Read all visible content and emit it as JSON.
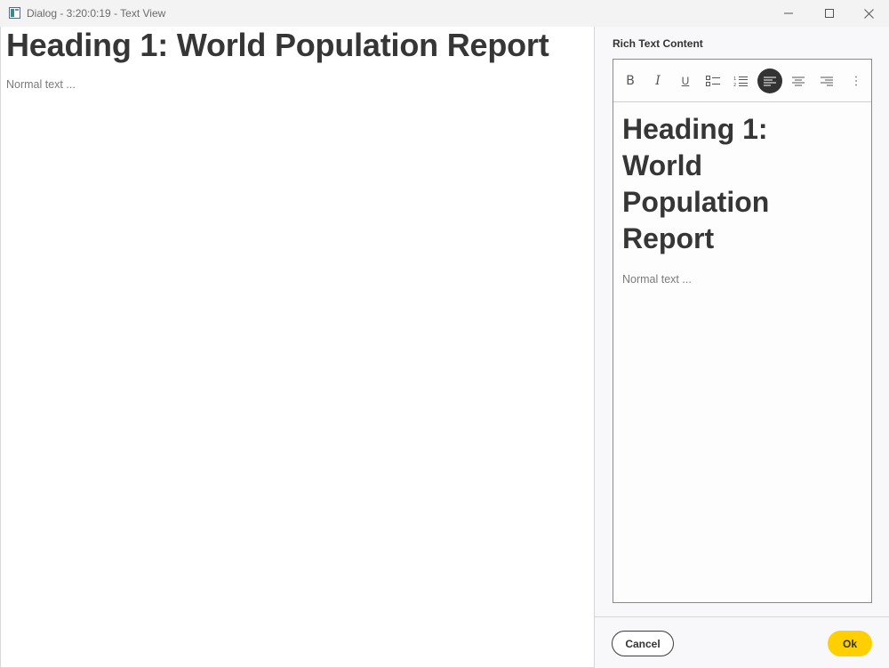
{
  "window": {
    "title": "Dialog - 3:20:0:19 - Text View",
    "icon": "app-window-icon",
    "controls": [
      "minimize-icon",
      "maximize-icon",
      "close-icon"
    ]
  },
  "preview": {
    "heading": "Heading 1: World Population Report",
    "normal_text": "Normal text ..."
  },
  "editor_panel": {
    "label": "Rich Text Content",
    "toolbar": {
      "bold": "B",
      "italic": "I",
      "underline": "U",
      "buttons": [
        "bold-icon",
        "italic-icon",
        "underline-icon",
        "bullet-list-icon",
        "numbered-list-icon",
        "align-left-icon",
        "align-center-icon",
        "align-right-icon",
        "more-options-icon"
      ],
      "active": "align-left-icon"
    },
    "content": {
      "heading": "Heading 1: World Population Report",
      "normal_text": "Normal text ..."
    }
  },
  "footer": {
    "cancel_label": "Cancel",
    "ok_label": "Ok"
  },
  "colors": {
    "accent": "#ffcf00",
    "active_button": "#333333",
    "panel_background": "#f8f8fa"
  }
}
